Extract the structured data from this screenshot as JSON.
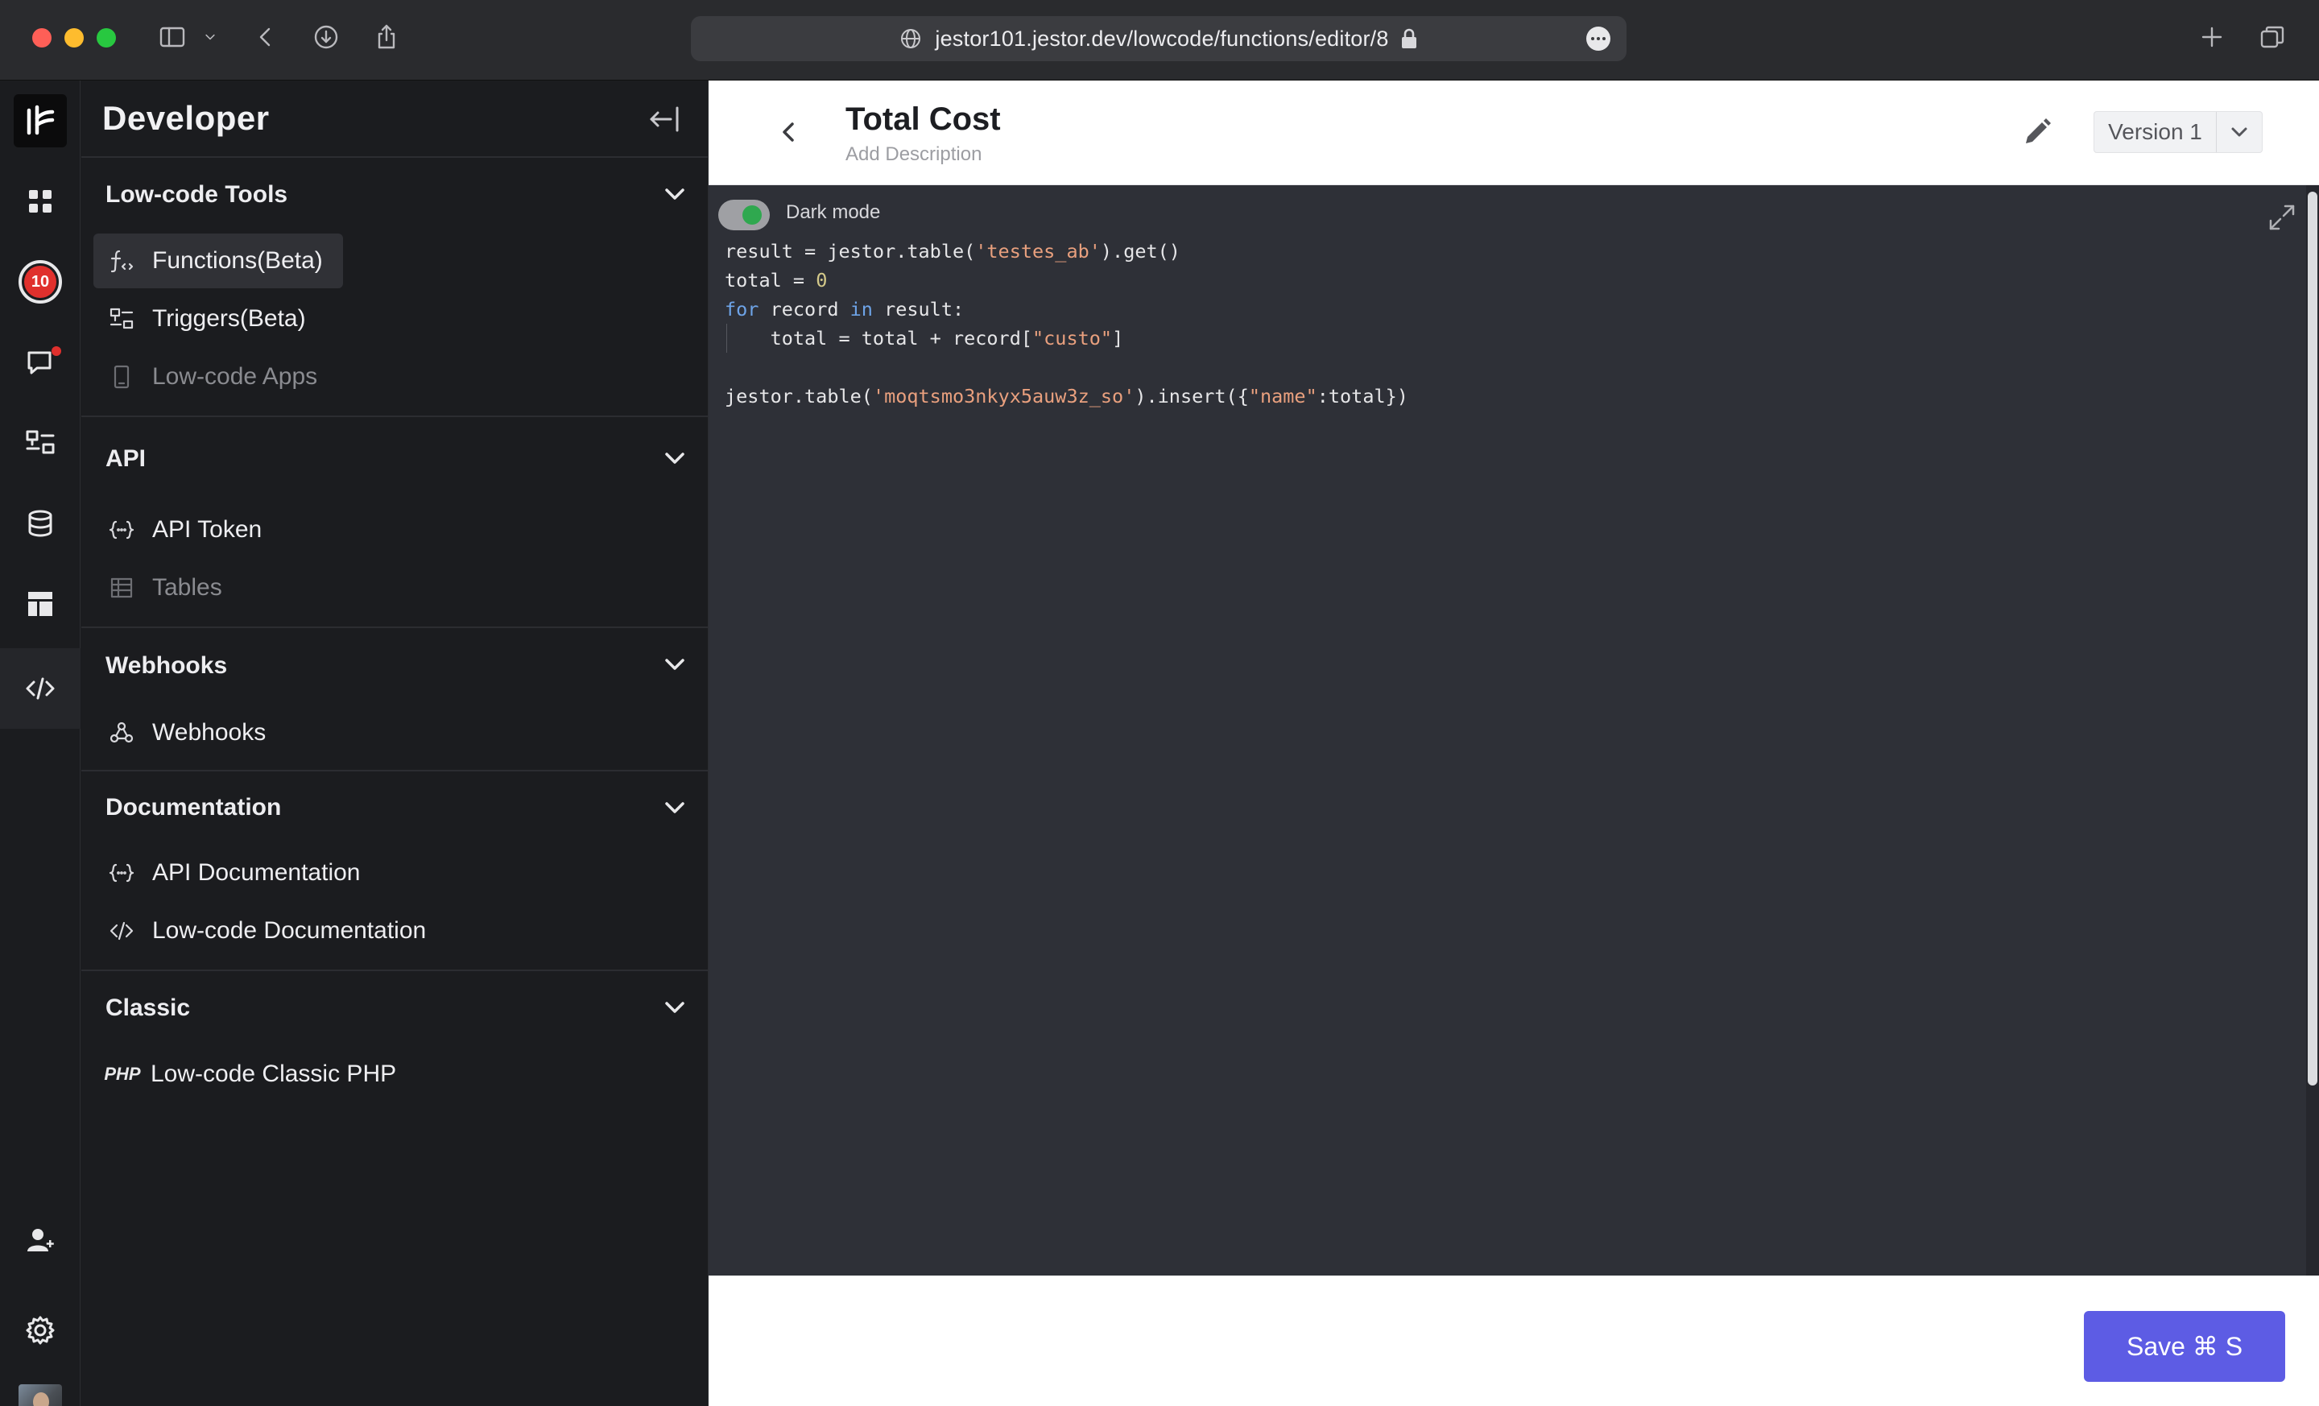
{
  "browser": {
    "url": "jestor101.jestor.dev/lowcode/functions/editor/8"
  },
  "rail": {
    "notification_count": "10"
  },
  "sidebar": {
    "title": "Developer",
    "sections": [
      {
        "title": "Low-code Tools",
        "items": [
          {
            "label": "Functions(Beta)",
            "icon": "function-icon",
            "selected": true
          },
          {
            "label": "Triggers(Beta)",
            "icon": "triggers-icon"
          },
          {
            "label": "Low-code Apps",
            "icon": "apps-icon",
            "muted": true
          }
        ]
      },
      {
        "title": "API",
        "items": [
          {
            "label": "API Token",
            "icon": "token-icon"
          },
          {
            "label": "Tables",
            "icon": "table-icon",
            "muted": true
          }
        ]
      },
      {
        "title": "Webhooks",
        "items": [
          {
            "label": "Webhooks",
            "icon": "webhook-icon"
          }
        ]
      },
      {
        "title": "Documentation",
        "items": [
          {
            "label": "API Documentation",
            "icon": "token-icon"
          },
          {
            "label": "Low-code Documentation",
            "icon": "code-icon"
          }
        ]
      },
      {
        "title": "Classic",
        "items": [
          {
            "label": "Low-code Classic PHP",
            "icon_text": "PHP"
          }
        ]
      }
    ]
  },
  "main": {
    "title": "Total Cost",
    "description_placeholder": "Add Description",
    "version": "Version 1",
    "dark_mode_label": "Dark mode",
    "dark_mode_on": true,
    "save_label": "Save ⌘ S"
  },
  "code": {
    "lines": [
      [
        {
          "t": "result = jestor.table("
        },
        {
          "t": "'testes_ab'",
          "c": "s"
        },
        {
          "t": ").get()"
        }
      ],
      [
        {
          "t": "total = "
        },
        {
          "t": "0",
          "c": "n"
        }
      ],
      [
        {
          "t": "for",
          "c": "k"
        },
        {
          "t": " record "
        },
        {
          "t": "in",
          "c": "k"
        },
        {
          "t": " result:"
        }
      ],
      [
        {
          "t": "    total = total + record["
        },
        {
          "t": "\"custo\"",
          "c": "s"
        },
        {
          "t": "]"
        }
      ],
      [],
      [
        {
          "t": "jestor.table("
        },
        {
          "t": "'moqtsmo3nkyx5auw3z_so'",
          "c": "s"
        },
        {
          "t": ").insert({"
        },
        {
          "t": "\"name\"",
          "c": "s"
        },
        {
          "t": ":total})"
        }
      ]
    ]
  },
  "colors": {
    "accent": "#5d5ce4",
    "badge": "#e0302d",
    "toggle_on": "#2fa84f"
  }
}
